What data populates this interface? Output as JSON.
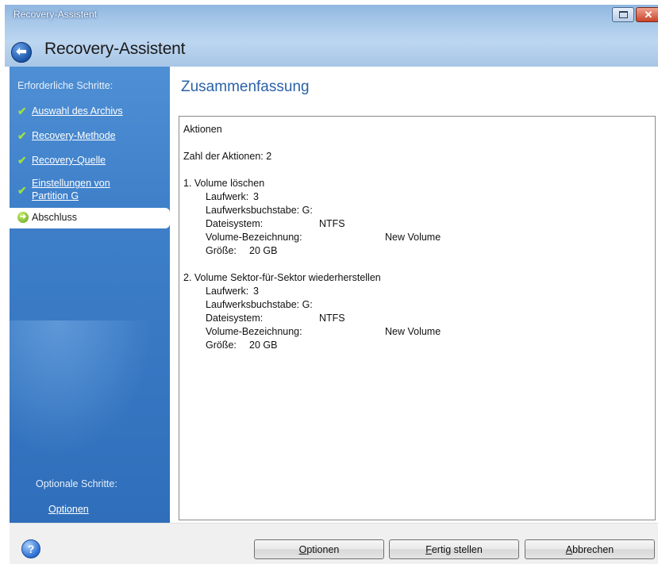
{
  "window": {
    "title_small": "Recovery-Assistent",
    "title_large": "Recovery-Assistent"
  },
  "sidebar": {
    "heading": "Erforderliche Schritte:",
    "steps": [
      {
        "label": "Auswahl des Archivs",
        "done": true
      },
      {
        "label": "Recovery-Methode",
        "done": true
      },
      {
        "label": "Recovery-Quelle",
        "done": true
      },
      {
        "label_line1": "Einstellungen von",
        "label_line2": "Partition G",
        "done": true
      },
      {
        "label": "Abschluss",
        "active": true
      }
    ],
    "optional_heading": "Optionale Schritte:",
    "optional_link": "Optionen"
  },
  "main": {
    "heading": "Zusammenfassung",
    "summary": {
      "title": "Aktionen",
      "count": "Zahl der Aktionen: 2",
      "actions": [
        {
          "title": "1. Volume löschen",
          "rows": [
            {
              "label": "Laufwerk:",
              "value": "3"
            },
            {
              "label": "Laufwerksbuchstabe: G:",
              "value": ""
            },
            {
              "label": "Dateisystem:",
              "value": "NTFS"
            },
            {
              "label": "Volume-Bezeichnung:",
              "value": "New Volume"
            },
            {
              "label": "Größe:",
              "value": "20 GB"
            }
          ]
        },
        {
          "title": "2. Volume Sektor-für-Sektor wiederherstellen",
          "rows": [
            {
              "label": "Laufwerk:",
              "value": "3"
            },
            {
              "label": "Laufwerksbuchstabe: G:",
              "value": ""
            },
            {
              "label": "Dateisystem:",
              "value": "NTFS"
            },
            {
              "label": "Volume-Bezeichnung:",
              "value": "New Volume"
            },
            {
              "label": "Größe:",
              "value": "20 GB"
            }
          ]
        }
      ]
    }
  },
  "footer": {
    "help_icon": "question-icon",
    "buttons": {
      "options_u": "O",
      "options_rest": "ptionen",
      "finish_u": "F",
      "finish_rest": "ertig stellen",
      "cancel_u": "A",
      "cancel_rest": "bbrechen"
    }
  }
}
